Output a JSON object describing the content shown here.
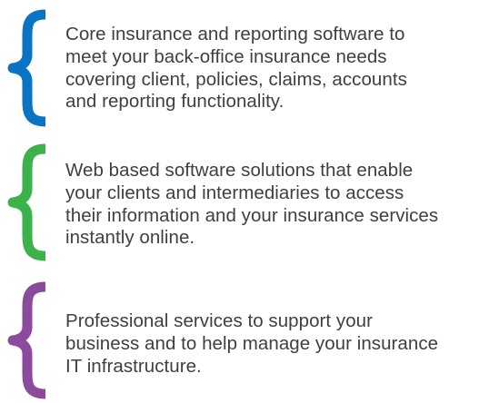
{
  "items": [
    {
      "text": "Core insurance and reporting software to\nmeet your back-office insurance needs\ncovering client, policies, claims, accounts\nand reporting functionality.",
      "brace_color": "#0a74c4"
    },
    {
      "text": "Web based software solutions that enable\nyour clients and intermediaries to access\ntheir information and your insurance services\ninstantly online.",
      "brace_color": "#3bb24a"
    },
    {
      "text": "Professional services to support your\nbusiness and to help manage your insurance\nIT infrastructure.",
      "brace_color": "#8b4a9c"
    }
  ],
  "icons": [
    "curly-brace-icon",
    "curly-brace-icon",
    "curly-brace-icon"
  ]
}
